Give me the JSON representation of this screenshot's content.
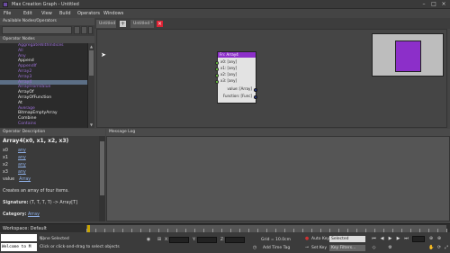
{
  "window": {
    "title": "Max Creation Graph - Untitled"
  },
  "menu": [
    "File",
    "Edit",
    "View",
    "Build",
    "Operators",
    "Windows"
  ],
  "left_panel": {
    "header": "Available Nodes/Operators",
    "search_value": "",
    "list_header": "Operator Nodes",
    "items": [
      {
        "label": "AggregateWithIndices",
        "style": "purple"
      },
      {
        "label": "All",
        "style": "purple"
      },
      {
        "label": "Any",
        "style": "purple"
      },
      {
        "label": "Append",
        "style": "white"
      },
      {
        "label": "AppendIf",
        "style": "purple"
      },
      {
        "label": "Array2",
        "style": "purple"
      },
      {
        "label": "Array3",
        "style": "purple"
      },
      {
        "label": "Array4",
        "style": "selected"
      },
      {
        "label": "ArrayFromValue",
        "style": "purple"
      },
      {
        "label": "ArrayOf",
        "style": "white"
      },
      {
        "label": "ArrayOfFunction",
        "style": "white"
      },
      {
        "label": "At",
        "style": "white"
      },
      {
        "label": "Average",
        "style": "purple"
      },
      {
        "label": "BitmapEmptyArray",
        "style": "white"
      },
      {
        "label": "Combine",
        "style": "white"
      },
      {
        "label": "Contains",
        "style": "purple"
      }
    ]
  },
  "tabs": {
    "first": "Untitled",
    "new_icon": "+",
    "second": "Untitled *",
    "close_icon": "×"
  },
  "node": {
    "title": "Fn: Array4",
    "inputs": [
      "x0: [any]",
      "x1: [any]",
      "x2: [any]",
      "x3: [any]"
    ],
    "outputs": [
      "value: [Array]",
      "Function: [Func]"
    ]
  },
  "description": {
    "header": "Operator Description",
    "signature": "Array4(x0, x1, x2, x3)",
    "params": [
      {
        "name": "x0",
        "type": "any"
      },
      {
        "name": "x1",
        "type": "any"
      },
      {
        "name": "x2",
        "type": "any"
      },
      {
        "name": "x3",
        "type": "any"
      },
      {
        "name": "value",
        "type": "Array"
      }
    ],
    "summary": "Creates an array of four items.",
    "sig_label": "Signature:",
    "sig_value": "(T, T, T, T) -> Array[T]",
    "category_label": "Category:",
    "category_value": "Array"
  },
  "message_log": {
    "header": "Message Log"
  },
  "timeline": {
    "workspace": "Workspace: Default",
    "frame_pct": 0
  },
  "status": {
    "maxscript_text": "Welcome to M",
    "selection": "None Selected",
    "prompt": "Click or click-and-drag to select objects",
    "x_label": "X:",
    "y_label": "Y:",
    "z_label": "Z:",
    "grid": "Grid = 10.0cm",
    "add_time_tag": "Add Time Tag",
    "auto_key": "Auto Key",
    "set_key": "Set Key",
    "key_mode": "Selected",
    "key_filters": "Key Filters..."
  },
  "colors": {
    "accent": "#8c2fc9",
    "selection": "#5c6f86",
    "input_port": "#6cd23a",
    "output_port": "#2a3f9a",
    "time_slider": "#c8a400"
  }
}
